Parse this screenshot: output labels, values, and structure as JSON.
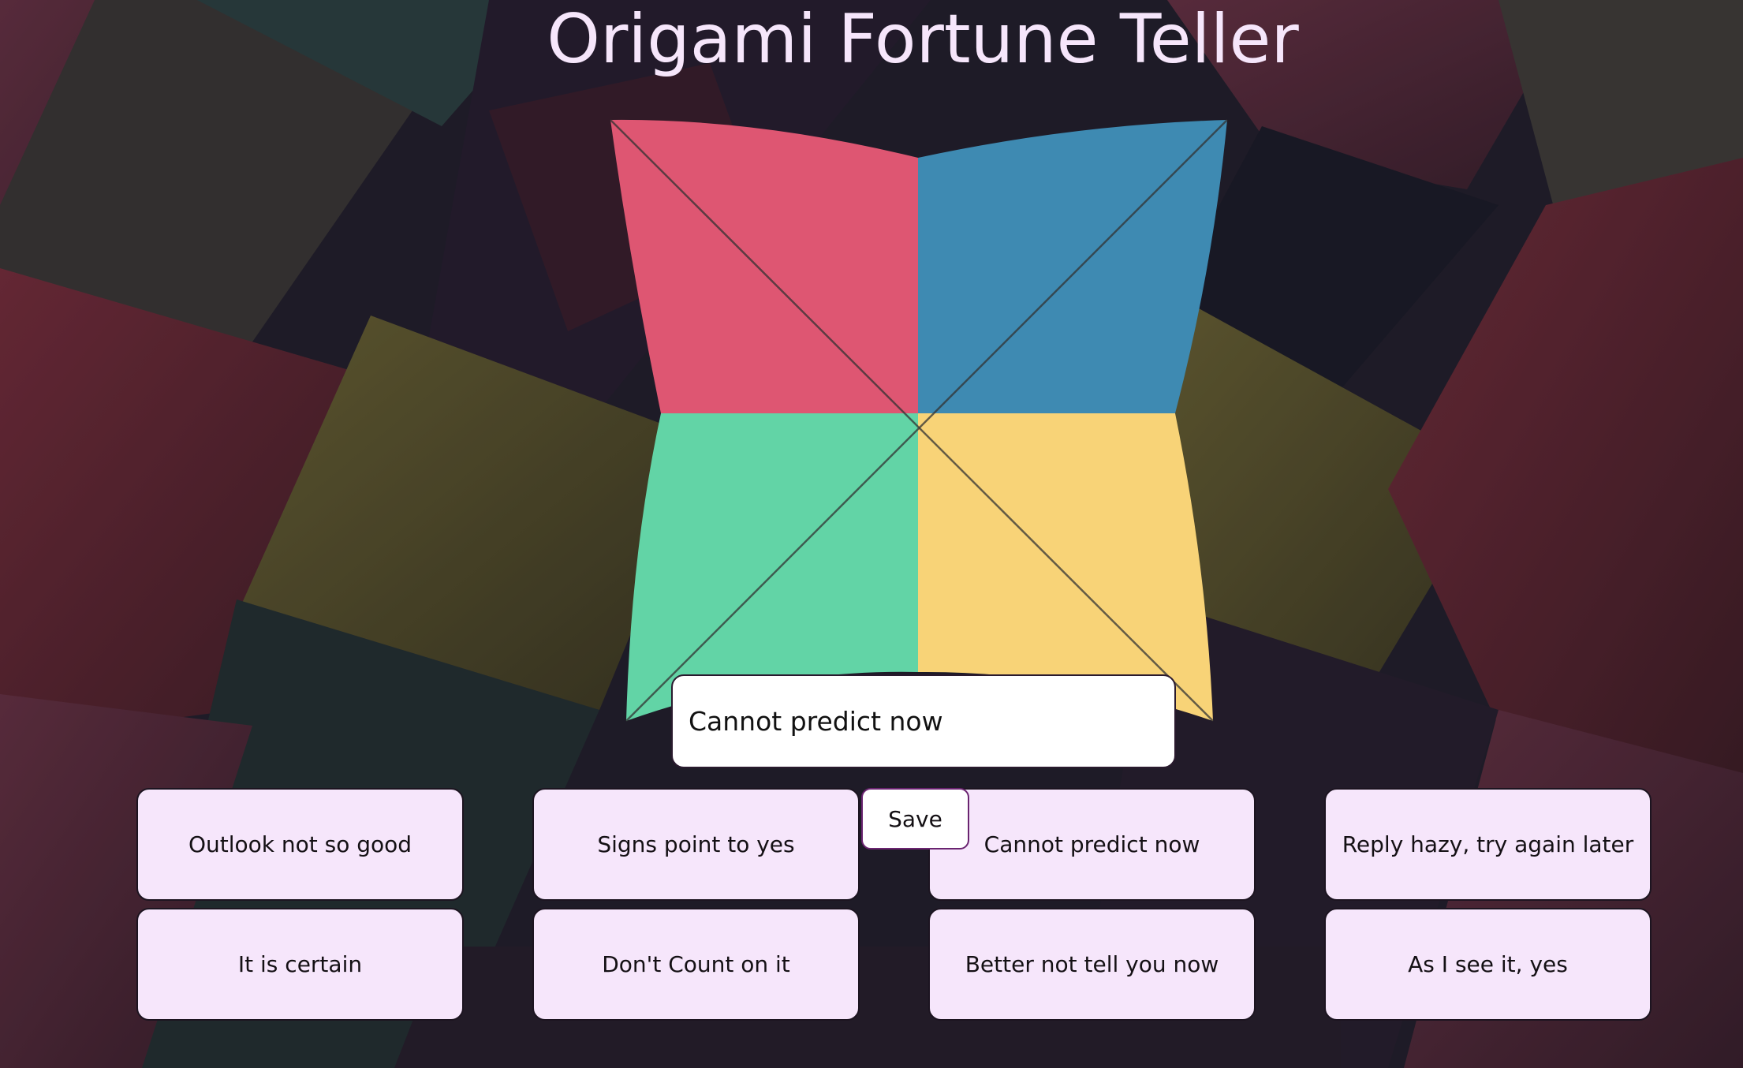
{
  "page": {
    "title": "Origami Fortune Teller"
  },
  "background": {
    "description_colors": [
      "#3a2a33",
      "#2e3a3c",
      "#1f1e2c",
      "#5a2a3a",
      "#6b6236",
      "#4a4a44"
    ]
  },
  "teller": {
    "colors": {
      "top_left": "#de5672",
      "top_right": "#3e8ab2",
      "bottom_left": "#62d4a6",
      "bottom_right": "#f8d377",
      "crease": "#333333"
    }
  },
  "fortune": {
    "current": "Cannot predict now"
  },
  "save": {
    "label": "Save"
  },
  "answers": [
    "Outlook not so good",
    "Signs point to yes",
    "Cannot predict now",
    "Reply hazy, try again later",
    "It is certain",
    "Don't Count on it",
    "Better not tell you now",
    "As I see it, yes"
  ]
}
